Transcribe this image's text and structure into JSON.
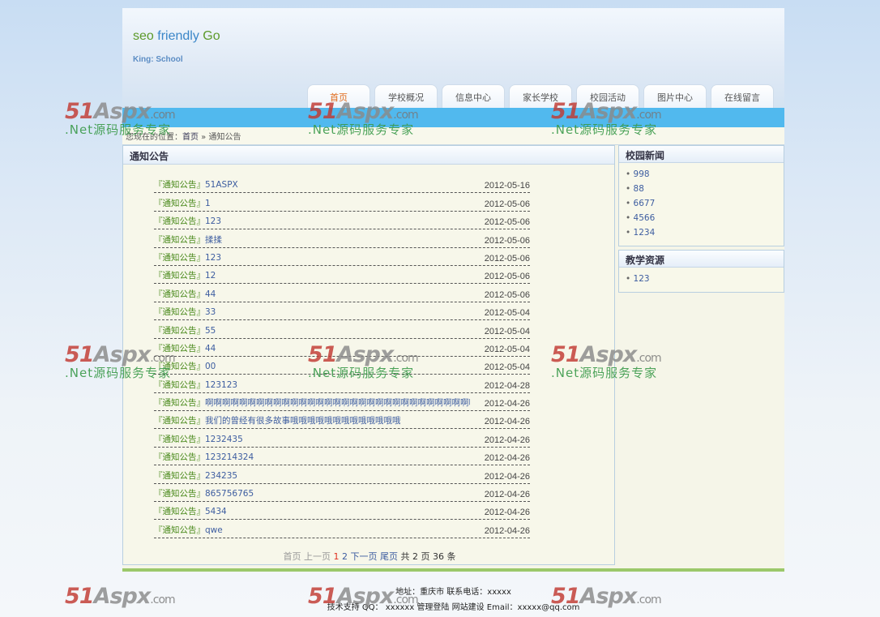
{
  "header": {
    "brand_1": "seo",
    "brand_2": " friendly",
    "brand_3": " Go",
    "slogan": "King: School"
  },
  "nav": [
    "首页",
    "学校概况",
    "信息中心",
    "家长学校",
    "校园活动",
    "图片中心",
    "在线留言"
  ],
  "breadcrumb": {
    "prefix": "您现在的位置：",
    "home": "首页",
    "sep": " » ",
    "current": "通知公告"
  },
  "main": {
    "title": "通知公告",
    "tag": "『通知公告』",
    "items": [
      {
        "title": "51ASPX",
        "date": "2012-05-16"
      },
      {
        "title": "1",
        "date": "2012-05-06"
      },
      {
        "title": "123",
        "date": "2012-05-06"
      },
      {
        "title": "揉揉",
        "date": "2012-05-06"
      },
      {
        "title": "123",
        "date": "2012-05-06"
      },
      {
        "title": "12",
        "date": "2012-05-06"
      },
      {
        "title": "44",
        "date": "2012-05-06"
      },
      {
        "title": "33",
        "date": "2012-05-04"
      },
      {
        "title": "55",
        "date": "2012-05-04"
      },
      {
        "title": "44",
        "date": "2012-05-04"
      },
      {
        "title": "00",
        "date": "2012-05-04"
      },
      {
        "title": "123123",
        "date": "2012-04-28"
      },
      {
        "title": "啊啊啊啊啊啊啊啊啊啊啊啊啊啊啊啊啊啊啊啊啊啊啊啊啊啊啊啊啊啊啊啊",
        "date": "2012-04-26"
      },
      {
        "title": "我们的曾经有很多故事哦哦哦哦哦哦哦哦哦哦哦哦哦",
        "date": "2012-04-26"
      },
      {
        "title": "1232435",
        "date": "2012-04-26"
      },
      {
        "title": "123214324",
        "date": "2012-04-26"
      },
      {
        "title": "234235",
        "date": "2012-04-26"
      },
      {
        "title": "865756765",
        "date": "2012-04-26"
      },
      {
        "title": "5434",
        "date": "2012-04-26"
      },
      {
        "title": "qwe",
        "date": "2012-04-26"
      }
    ],
    "pager": {
      "first": "首页",
      "prev": "上一页",
      "page1": "1",
      "page2": "2",
      "next": "下一页",
      "last": "尾页",
      "summary": "共 2 页 36 条"
    }
  },
  "sidebar": {
    "news_title": "校园新闻",
    "news": [
      "998",
      "88",
      "6677",
      "4566",
      "1234"
    ],
    "resources_title": "教学资源",
    "resources": [
      "123"
    ]
  },
  "footer": {
    "line1": "地址：重庆市   联系电话：xxxxx",
    "line2": "技术支持 QQ： xxxxxx   管理登陆   网站建设 Email：xxxxx@qq.com"
  },
  "watermark": {
    "logo_num": "51",
    "logo_as": "Aspx",
    "logo_com": ".com",
    "sub": ".Net源码服务专家"
  }
}
